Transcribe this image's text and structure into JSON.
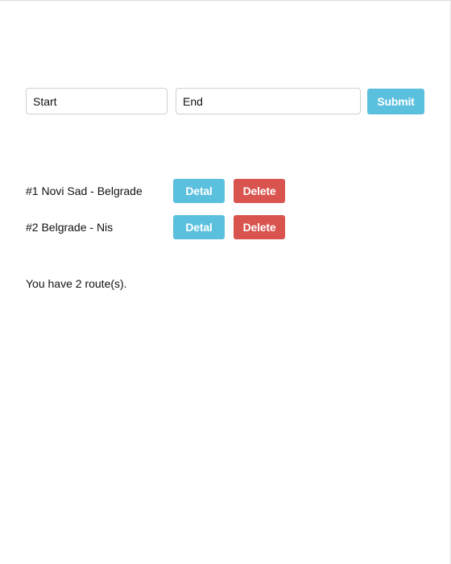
{
  "form": {
    "start_value": "Start",
    "end_value": "End",
    "submit_label": "Submit"
  },
  "routes": [
    {
      "label": "#1 Novi Sad - Belgrade",
      "detail_label": "Detal",
      "delete_label": "Delete"
    },
    {
      "label": "#2 Belgrade - Nis",
      "detail_label": "Detal",
      "delete_label": "Delete"
    }
  ],
  "summary": {
    "text": "You have 2 route(s)."
  },
  "colors": {
    "info": "#5bc0de",
    "danger": "#d9534f"
  }
}
